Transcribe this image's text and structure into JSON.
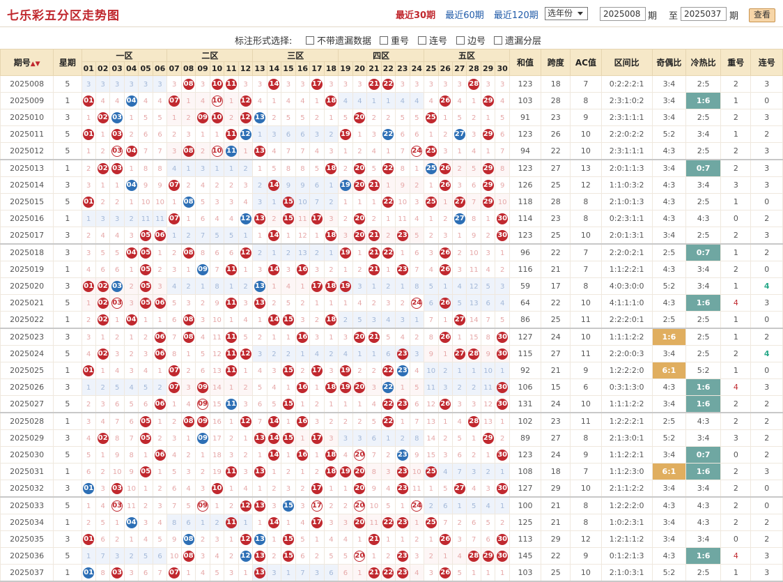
{
  "header": {
    "title": "七乐彩五分区走势图",
    "nav": [
      "最近30期",
      "最近60期",
      "最近120期"
    ],
    "year_select": "选年份",
    "from_issue": "2025008",
    "issue_label": "期",
    "to_label": "至",
    "to_issue": "2025037",
    "view_button": "查看"
  },
  "options": {
    "label": "标注形式选择:",
    "items": [
      "不带遗漏数据",
      "重号",
      "连号",
      "边号",
      "遗漏分层"
    ]
  },
  "columns": {
    "issue": "期号",
    "week": "星期",
    "zones": [
      "一区",
      "二区",
      "三区",
      "四区",
      "五区"
    ],
    "numbers": [
      "01",
      "02",
      "03",
      "04",
      "05",
      "06",
      "07",
      "08",
      "09",
      "10",
      "11",
      "12",
      "13",
      "14",
      "15",
      "16",
      "17",
      "18",
      "19",
      "20",
      "21",
      "22",
      "23",
      "24",
      "25",
      "26",
      "27",
      "28",
      "29",
      "30"
    ],
    "sum": "和值",
    "span": "跨度",
    "ac": "AC值",
    "zone_ratio": "区间比",
    "odd_even": "奇偶比",
    "hot_cold": "冷热比",
    "repeat": "重号",
    "consec": "连号"
  },
  "rows": [
    {
      "issue": "2025008",
      "week": "5",
      "nums": [
        8,
        10,
        11,
        14,
        17,
        21,
        22,
        28
      ],
      "sum": "123",
      "span": "18",
      "ac": "7",
      "zr": "0:2:2:2:1",
      "oe": "3:4",
      "hc": "2:5",
      "rp": "2",
      "cs": "3"
    },
    {
      "issue": "2025009",
      "week": "1",
      "nums": [
        1,
        4,
        7,
        10,
        12,
        18,
        26,
        29
      ],
      "sum": "103",
      "span": "28",
      "ac": "8",
      "zr": "2:3:1:0:2",
      "oe": "3:4",
      "hc": "1:6",
      "hcHL": "g",
      "rp": "1",
      "cs": "0"
    },
    {
      "issue": "2025010",
      "week": "3",
      "nums": [
        2,
        3,
        9,
        10,
        12,
        13,
        20,
        25
      ],
      "sum": "91",
      "span": "23",
      "ac": "9",
      "zr": "2:3:1:1:1",
      "oe": "3:4",
      "hc": "2:5",
      "rp": "2",
      "cs": "3"
    },
    {
      "issue": "2025011",
      "week": "5",
      "nums": [
        1,
        3,
        11,
        12,
        19,
        22,
        27,
        29
      ],
      "sum": "123",
      "span": "26",
      "ac": "10",
      "zr": "2:2:0:2:2",
      "oe": "5:2",
      "hc": "3:4",
      "rp": "1",
      "cs": "2"
    },
    {
      "issue": "2025012",
      "week": "5",
      "nums": [
        3,
        4,
        8,
        10,
        11,
        13,
        24,
        25
      ],
      "sum": "94",
      "span": "22",
      "ac": "10",
      "zr": "2:3:1:1:1",
      "oe": "4:3",
      "hc": "2:5",
      "rp": "2",
      "cs": "3"
    },
    {
      "issue": "2025013",
      "week": "1",
      "nums": [
        2,
        3,
        18,
        20,
        22,
        25,
        26,
        29
      ],
      "sum": "123",
      "span": "27",
      "ac": "13",
      "zr": "2:0:1:1:3",
      "oe": "3:4",
      "hc": "0:7",
      "hcHL": "g",
      "rp": "2",
      "cs": "3"
    },
    {
      "issue": "2025014",
      "week": "3",
      "nums": [
        4,
        7,
        14,
        19,
        20,
        21,
        26,
        29
      ],
      "sum": "126",
      "span": "25",
      "ac": "12",
      "zr": "1:1:0:3:2",
      "oe": "4:3",
      "hc": "3:4",
      "rp": "3",
      "cs": "3"
    },
    {
      "issue": "2025015",
      "week": "5",
      "nums": [
        1,
        8,
        15,
        22,
        25,
        27,
        29
      ],
      "sum": "118",
      "span": "28",
      "ac": "8",
      "zr": "2:1:0:1:3",
      "oe": "4:3",
      "hc": "2:5",
      "rp": "1",
      "cs": "0"
    },
    {
      "issue": "2025016",
      "week": "1",
      "nums": [
        7,
        12,
        13,
        15,
        17,
        20,
        27,
        30
      ],
      "sum": "114",
      "span": "23",
      "ac": "8",
      "zr": "0:2:3:1:1",
      "oe": "4:3",
      "hc": "4:3",
      "rp": "0",
      "cs": "2"
    },
    {
      "issue": "2025017",
      "week": "3",
      "nums": [
        5,
        6,
        14,
        18,
        20,
        21,
        23,
        30
      ],
      "sum": "123",
      "span": "25",
      "ac": "10",
      "zr": "2:0:1:3:1",
      "oe": "3:4",
      "hc": "2:5",
      "rp": "2",
      "cs": "3"
    },
    {
      "issue": "2025018",
      "week": "3",
      "nums": [
        4,
        5,
        8,
        12,
        19,
        21,
        22,
        26
      ],
      "sum": "96",
      "span": "22",
      "ac": "7",
      "zr": "2:2:0:2:1",
      "oe": "2:5",
      "hc": "0:7",
      "hcHL": "g",
      "rp": "1",
      "cs": "2"
    },
    {
      "issue": "2025019",
      "week": "1",
      "nums": [
        5,
        9,
        11,
        14,
        16,
        21,
        23,
        26
      ],
      "sum": "116",
      "span": "21",
      "ac": "7",
      "zr": "1:1:2:2:1",
      "oe": "4:3",
      "hc": "3:4",
      "rp": "2",
      "cs": "0"
    },
    {
      "issue": "2025020",
      "week": "3",
      "nums": [
        1,
        2,
        3,
        5,
        13,
        17,
        18,
        19
      ],
      "sum": "59",
      "span": "17",
      "ac": "8",
      "zr": "4:0:3:0:0",
      "oe": "5:2",
      "hc": "3:4",
      "rp": "1",
      "cs": "4",
      "csT": "1"
    },
    {
      "issue": "2025021",
      "week": "5",
      "nums": [
        2,
        3,
        5,
        6,
        11,
        13,
        24,
        26
      ],
      "sum": "64",
      "span": "22",
      "ac": "10",
      "zr": "4:1:1:1:0",
      "oe": "4:3",
      "hc": "1:6",
      "hcHL": "g",
      "rp": "4",
      "rpR": "1",
      "cs": "3"
    },
    {
      "issue": "2025022",
      "week": "1",
      "nums": [
        2,
        4,
        8,
        14,
        15,
        18,
        27
      ],
      "sum": "86",
      "span": "25",
      "ac": "11",
      "zr": "2:2:2:0:1",
      "oe": "2:5",
      "hc": "2:5",
      "rp": "1",
      "cs": "0"
    },
    {
      "issue": "2025023",
      "week": "3",
      "nums": [
        6,
        8,
        11,
        16,
        20,
        21,
        26,
        30
      ],
      "sum": "127",
      "span": "24",
      "ac": "10",
      "zr": "1:1:1:2:2",
      "oe": "1:6",
      "oeHL": "o",
      "hc": "2:5",
      "rp": "1",
      "cs": "2"
    },
    {
      "issue": "2025024",
      "week": "5",
      "nums": [
        2,
        6,
        11,
        12,
        23,
        27,
        28,
        30
      ],
      "sum": "115",
      "span": "27",
      "ac": "11",
      "zr": "2:2:0:0:3",
      "oe": "3:4",
      "hc": "2:5",
      "rp": "2",
      "cs": "4",
      "csT": "1"
    },
    {
      "issue": "2025025",
      "week": "1",
      "nums": [
        1,
        7,
        11,
        15,
        17,
        19,
        22,
        23
      ],
      "sum": "92",
      "span": "21",
      "ac": "9",
      "zr": "1:2:2:2:0",
      "oe": "6:1",
      "oeHL": "o",
      "hc": "5:2",
      "rp": "1",
      "cs": "0"
    },
    {
      "issue": "2025026",
      "week": "3",
      "nums": [
        7,
        9,
        16,
        18,
        19,
        20,
        22,
        30
      ],
      "sum": "106",
      "span": "15",
      "ac": "6",
      "zr": "0:3:1:3:0",
      "oe": "4:3",
      "hc": "1:6",
      "hcHL": "g",
      "rp": "4",
      "rpR": "1",
      "cs": "3"
    },
    {
      "issue": "2025027",
      "week": "5",
      "nums": [
        6,
        9,
        11,
        15,
        22,
        23,
        26,
        30
      ],
      "sum": "131",
      "span": "24",
      "ac": "10",
      "zr": "1:1:1:2:2",
      "oe": "3:4",
      "hc": "1:6",
      "hcHL": "g",
      "rp": "2",
      "cs": "2"
    },
    {
      "issue": "2025028",
      "week": "1",
      "nums": [
        5,
        8,
        9,
        12,
        14,
        16,
        22,
        28
      ],
      "sum": "102",
      "span": "23",
      "ac": "11",
      "zr": "1:2:2:2:1",
      "oe": "2:5",
      "hc": "4:3",
      "rp": "2",
      "cs": "2"
    },
    {
      "issue": "2025029",
      "week": "3",
      "nums": [
        2,
        5,
        9,
        13,
        14,
        15,
        17,
        29
      ],
      "sum": "89",
      "span": "27",
      "ac": "8",
      "zr": "2:1:3:0:1",
      "oe": "5:2",
      "hc": "3:4",
      "rp": "3",
      "cs": "2"
    },
    {
      "issue": "2025030",
      "week": "5",
      "nums": [
        6,
        14,
        16,
        18,
        20,
        23,
        30
      ],
      "sum": "123",
      "span": "24",
      "ac": "9",
      "zr": "1:1:2:2:1",
      "oe": "3:4",
      "hc": "0:7",
      "hcHL": "g",
      "rp": "0",
      "cs": "2"
    },
    {
      "issue": "2025031",
      "week": "1",
      "nums": [
        5,
        11,
        13,
        18,
        19,
        20,
        23,
        25
      ],
      "sum": "108",
      "span": "18",
      "ac": "7",
      "zr": "1:1:2:3:0",
      "oe": "6:1",
      "oeHL": "o",
      "hc": "1:6",
      "hcHL": "g",
      "rp": "2",
      "cs": "3"
    },
    {
      "issue": "2025032",
      "week": "3",
      "nums": [
        1,
        3,
        10,
        17,
        20,
        23,
        27,
        30
      ],
      "sum": "127",
      "span": "29",
      "ac": "10",
      "zr": "2:1:1:2:2",
      "oe": "3:4",
      "hc": "3:4",
      "rp": "2",
      "cs": "0"
    },
    {
      "issue": "2025033",
      "week": "5",
      "nums": [
        3,
        9,
        12,
        13,
        15,
        17,
        20,
        24
      ],
      "sum": "100",
      "span": "21",
      "ac": "8",
      "zr": "1:2:2:2:0",
      "oe": "4:3",
      "hc": "4:3",
      "rp": "2",
      "cs": "0"
    },
    {
      "issue": "2025034",
      "week": "1",
      "nums": [
        4,
        11,
        14,
        17,
        20,
        22,
        23,
        25
      ],
      "sum": "125",
      "span": "21",
      "ac": "8",
      "zr": "1:0:2:3:1",
      "oe": "3:4",
      "hc": "4:3",
      "rp": "2",
      "cs": "2"
    },
    {
      "issue": "2025035",
      "week": "3",
      "nums": [
        1,
        8,
        12,
        13,
        15,
        21,
        26,
        30
      ],
      "sum": "113",
      "span": "29",
      "ac": "12",
      "zr": "1:2:1:1:2",
      "oe": "3:4",
      "hc": "3:4",
      "rp": "0",
      "cs": "2"
    },
    {
      "issue": "2025036",
      "week": "5",
      "nums": [
        8,
        12,
        13,
        15,
        20,
        23,
        28,
        29,
        30
      ],
      "sum": "145",
      "span": "22",
      "ac": "9",
      "zr": "0:1:2:1:3",
      "oe": "4:3",
      "hc": "1:6",
      "hcHL": "g",
      "rp": "4",
      "rpR": "1",
      "cs": "3"
    },
    {
      "issue": "2025037",
      "week": "1",
      "nums": [
        1,
        3,
        7,
        13,
        21,
        22,
        23,
        26
      ],
      "sum": "103",
      "span": "25",
      "ac": "10",
      "zr": "2:1:0:3:1",
      "oe": "5:2",
      "hc": "2:5",
      "rp": "1",
      "cs": "3"
    }
  ],
  "colors": {
    "accent": "#c0282e",
    "blue": "#2d6fb5",
    "header_bg": "#f6e8c8",
    "hot_green": "#6fa7a2",
    "odd_orange": "#e0ae5f"
  }
}
